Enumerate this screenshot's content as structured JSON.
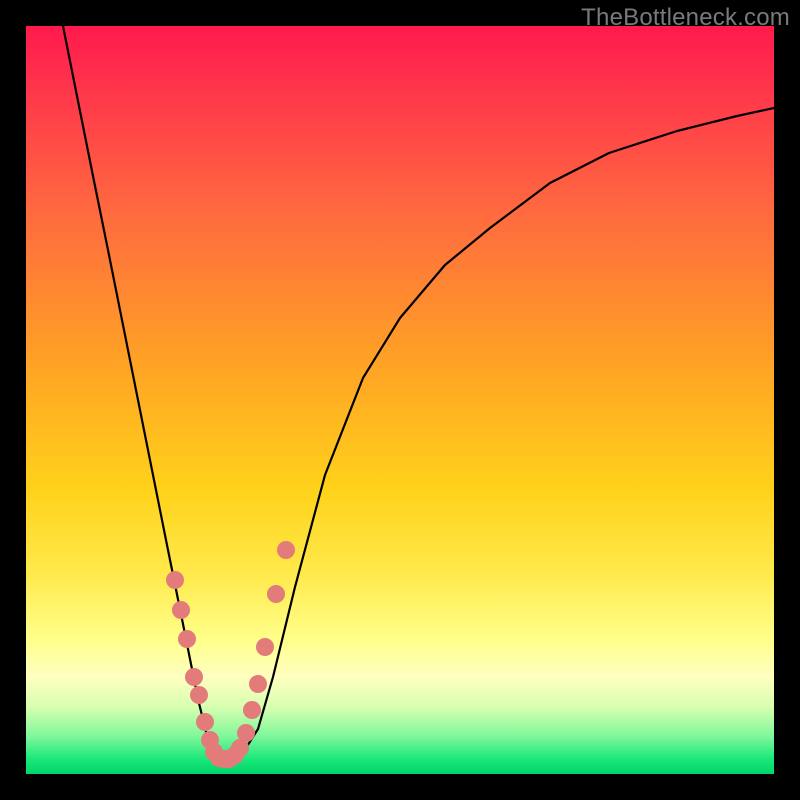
{
  "watermark": "TheBottleneck.com",
  "chart_data": {
    "type": "line",
    "title": "",
    "xlabel": "",
    "ylabel": "",
    "xlim": [
      0,
      1
    ],
    "ylim": [
      0,
      1
    ],
    "grid": false,
    "legend": false,
    "series": [
      {
        "name": "bottleneck-curve",
        "color": "#000000",
        "x": [
          0.05,
          0.07,
          0.09,
          0.11,
          0.13,
          0.15,
          0.17,
          0.19,
          0.21,
          0.23,
          0.245,
          0.265,
          0.285,
          0.31,
          0.33,
          0.36,
          0.4,
          0.45,
          0.5,
          0.56,
          0.62,
          0.7,
          0.78,
          0.87,
          0.95,
          1.0
        ],
        "y": [
          1.0,
          0.9,
          0.8,
          0.7,
          0.6,
          0.5,
          0.4,
          0.3,
          0.2,
          0.1,
          0.04,
          0.02,
          0.02,
          0.06,
          0.13,
          0.25,
          0.4,
          0.53,
          0.61,
          0.68,
          0.73,
          0.79,
          0.83,
          0.86,
          0.88,
          0.89
        ]
      },
      {
        "name": "highlight-dots",
        "color": "#e37b7b",
        "type": "scatter",
        "x": [
          0.199,
          0.207,
          0.215,
          0.225,
          0.231,
          0.239,
          0.246,
          0.252,
          0.258,
          0.265,
          0.272,
          0.279,
          0.286,
          0.294,
          0.302,
          0.31,
          0.32,
          0.334,
          0.347
        ],
        "y": [
          0.26,
          0.22,
          0.18,
          0.13,
          0.105,
          0.07,
          0.045,
          0.03,
          0.022,
          0.02,
          0.02,
          0.025,
          0.035,
          0.055,
          0.085,
          0.12,
          0.17,
          0.24,
          0.3
        ]
      }
    ],
    "background_gradient": {
      "top": "#ff1a4d",
      "mid": "#ffd21a",
      "bottom": "#00d46b"
    }
  }
}
